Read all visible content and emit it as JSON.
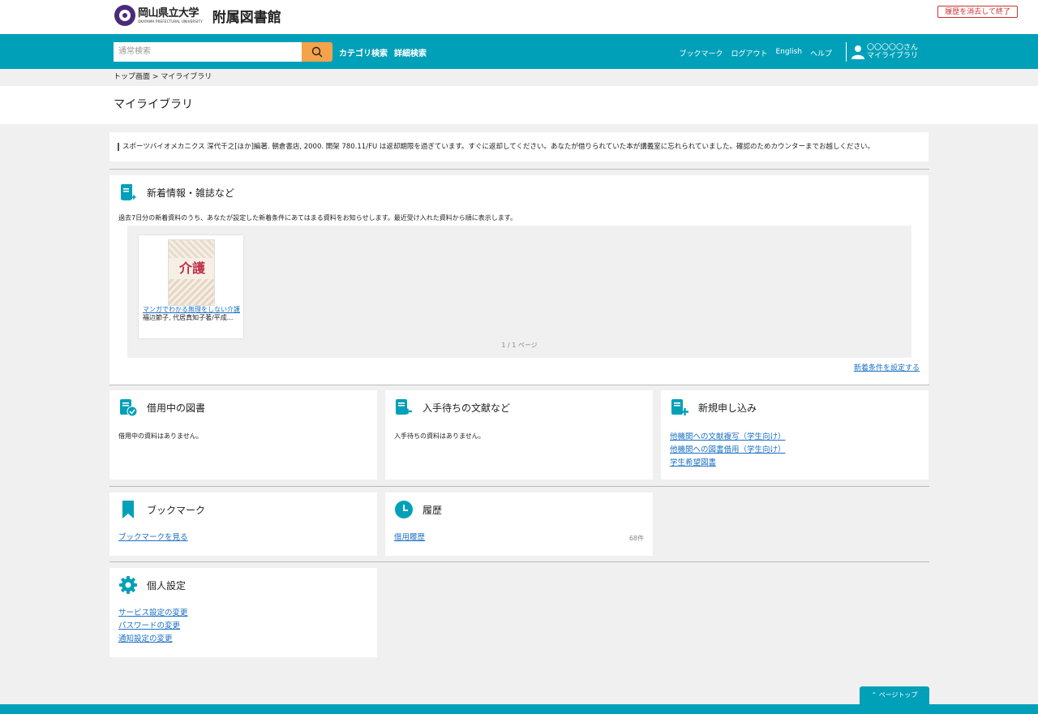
{
  "header": {
    "logo_text": "岡山県立大学",
    "logo_en": "OKAYAMA PREFECTURAL UNIVERSITY",
    "library_name": "附属図書館",
    "logout_clear_label": "履歴を消去して終了"
  },
  "nav": {
    "search_placeholder": "通常検索",
    "category_search": "カテゴリ検索",
    "advanced_search": "詳細検索",
    "bookmark": "ブックマーク",
    "logout": "ログアウト",
    "english": "English",
    "help": "ヘルプ",
    "user_name": "〇〇〇〇〇さん",
    "user_mylib": "マイライブラリ"
  },
  "breadcrumb": "トップ画面 > マイライブラリ",
  "page_title": "マイライブラリ",
  "notice": "スポーツバイオメカニクス 深代千之[ほか]編著. 朝倉書店, 2000. 開架 780.11/FU は返却期限を過ぎています。すぐに返却してください。あなたが借りられていた本が講義室に忘れられていました。確認のためカウンターまでお越しください。",
  "new_arrivals": {
    "title": "新着情報・雑誌など",
    "description": "過去7日分の新着資料のうち、あなたが設定した新着条件にあてはまる資料をお知らせします。最近受け入れた資料から順に表示します。",
    "book": {
      "cover_text": "介護",
      "title": "マンガでわかる無理をしない介護",
      "author": "福辺節子, 代居真知子著/平成..."
    },
    "pager": "1 / 1 ページ",
    "set_conditions": "新着条件を設定する"
  },
  "borrowing": {
    "title": "借用中の図書",
    "empty": "借用中の資料はありません。"
  },
  "waiting": {
    "title": "入手待ちの文献など",
    "empty": "入手待ちの資料はありません。"
  },
  "new_request": {
    "title": "新規申し込み",
    "links": [
      "他機関への文献複写（学生向け）",
      "他機関への図書借用（学生向け）",
      "学生希望図書"
    ]
  },
  "bookmarks": {
    "title": "ブックマーク",
    "link": "ブックマークを見る"
  },
  "history": {
    "title": "履歴",
    "link": "借用履歴",
    "count": "68件"
  },
  "settings": {
    "title": "個人設定",
    "links": [
      "サービス設定の変更",
      "パスワードの変更",
      "通知設定の変更"
    ]
  },
  "page_top": "ページトップ",
  "colors": {
    "brand": "#00a0b9",
    "search_button": "#f4a34a",
    "link": "#1a6fc4"
  }
}
